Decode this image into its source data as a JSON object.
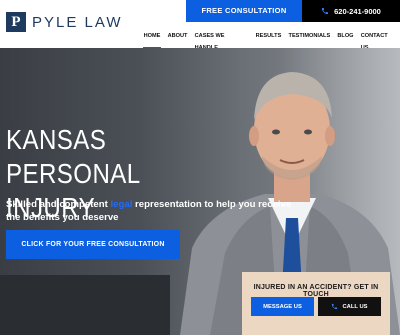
{
  "brand": {
    "mark": "P",
    "name": "PYLE LAW"
  },
  "top_cta": {
    "consult_label": "FREE CONSULTATION",
    "phone": "620-241-9000"
  },
  "nav": {
    "items": [
      "HOME",
      "ABOUT",
      "CASES WE HANDLE",
      "RESULTS",
      "TESTIMONIALS",
      "BLOG",
      "CONTACT US"
    ],
    "active": "HOME"
  },
  "hero": {
    "title_line1": "KANSAS PERSONAL",
    "title_line2": "INJURY ATTORNEY",
    "subtitle_before": "Skilled and competent ",
    "subtitle_highlight": "legal",
    "subtitle_after": " representation to help you receive the benefits you deserve",
    "button_label": "CLICK FOR YOUR FREE CONSULTATION"
  },
  "widget": {
    "title": "INJURED IN AN ACCIDENT? GET IN TOUCH",
    "message_label": "MESSAGE US",
    "call_label": "CALL US"
  },
  "colors": {
    "brand_blue": "#0b5fe0",
    "navy": "#1e3a5f",
    "widget_bg": "#ecd7c3"
  }
}
